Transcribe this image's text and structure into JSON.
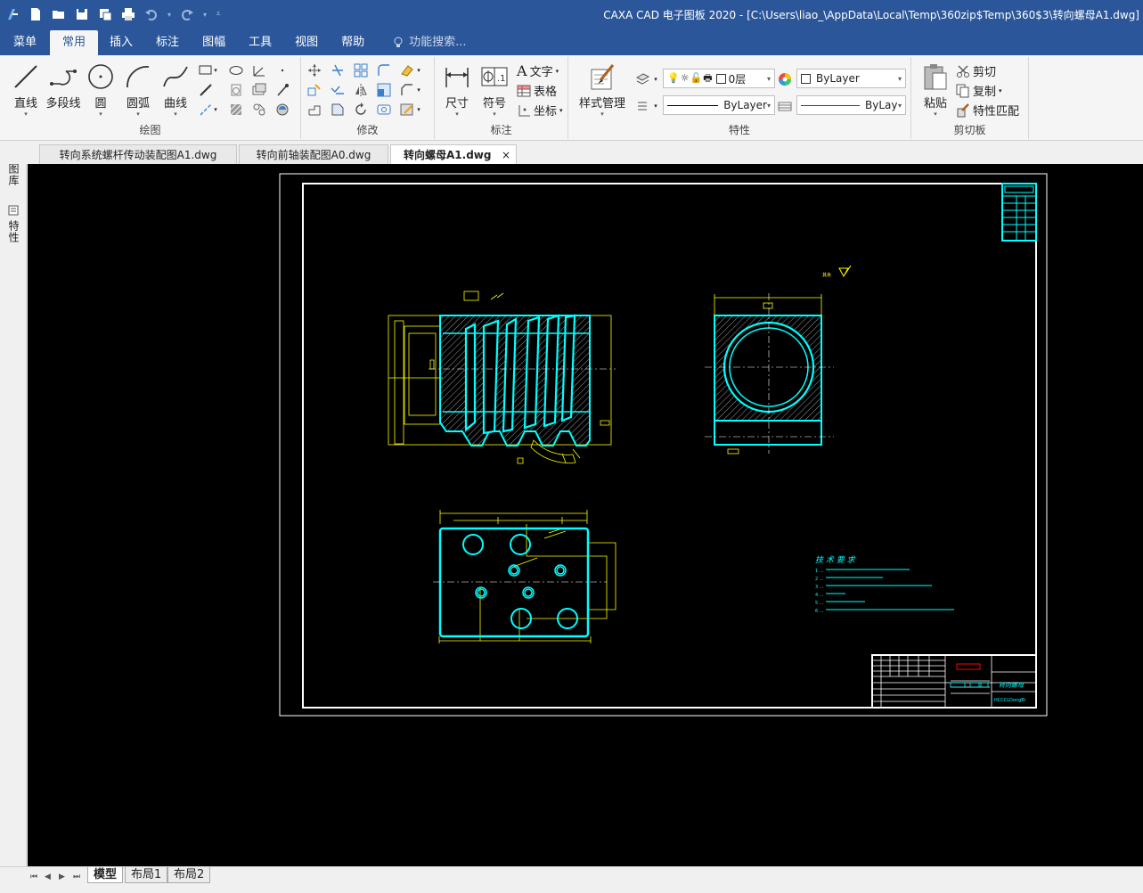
{
  "window": {
    "title": "CAXA CAD 电子图板 2020 - [C:\\Users\\liao_\\AppData\\Local\\Temp\\360zip$Temp\\360$3\\转向螺母A1.dwg]"
  },
  "menu_tabs": [
    {
      "label": "菜单"
    },
    {
      "label": "常用"
    },
    {
      "label": "插入"
    },
    {
      "label": "标注"
    },
    {
      "label": "图幅"
    },
    {
      "label": "工具"
    },
    {
      "label": "视图"
    },
    {
      "label": "帮助"
    }
  ],
  "search": {
    "label": "功能搜索..."
  },
  "ribbon": {
    "draw": {
      "label": "绘图",
      "line": "直线",
      "polyline": "多段线",
      "circle": "圆",
      "arc": "圆弧",
      "curve": "曲线"
    },
    "modify": {
      "label": "修改"
    },
    "annotate": {
      "label": "标注",
      "dimension": "尺寸",
      "symbol": "符号",
      "text": "文字",
      "table": "表格",
      "coordinate": "坐标"
    },
    "properties": {
      "label": "特性",
      "style_manager": "样式管理",
      "layer_value": "0层",
      "color_value": "ByLayer",
      "linetype_value": "ByLayer",
      "lineweight_value": "ByLay"
    },
    "clipboard": {
      "label": "剪切板",
      "paste": "粘贴",
      "cut": "剪切",
      "copy": "复制",
      "match": "特性匹配"
    }
  },
  "doc_tabs": [
    {
      "label": "转向系统螺杆传动装配图A1.dwg"
    },
    {
      "label": "转向前轴装配图A0.dwg"
    },
    {
      "label": "转向螺母A1.dwg",
      "close": "×"
    }
  ],
  "side_panel": {
    "library": "图库",
    "properties": "特性"
  },
  "layout_tabs": [
    {
      "label": "模型"
    },
    {
      "label": "布局1"
    },
    {
      "label": "布局2"
    }
  ],
  "drawing": {
    "roughness_note": "其余",
    "tech_title": "技 术 要 求",
    "tech_items": [
      "1  ...",
      "2  ...",
      "3  ...",
      "4  ...",
      "5  ...",
      "6  ..."
    ],
    "part_name": "转向螺母",
    "drawing_code": "HCCCLDongBi"
  },
  "colors": {
    "ribbon_blue": "#2b579a",
    "cad_cyan": "#00ffff",
    "cad_yellow": "#ffff00",
    "cad_white": "#ffffff",
    "cad_red": "#ff0000",
    "canvas_bg": "#000000"
  }
}
